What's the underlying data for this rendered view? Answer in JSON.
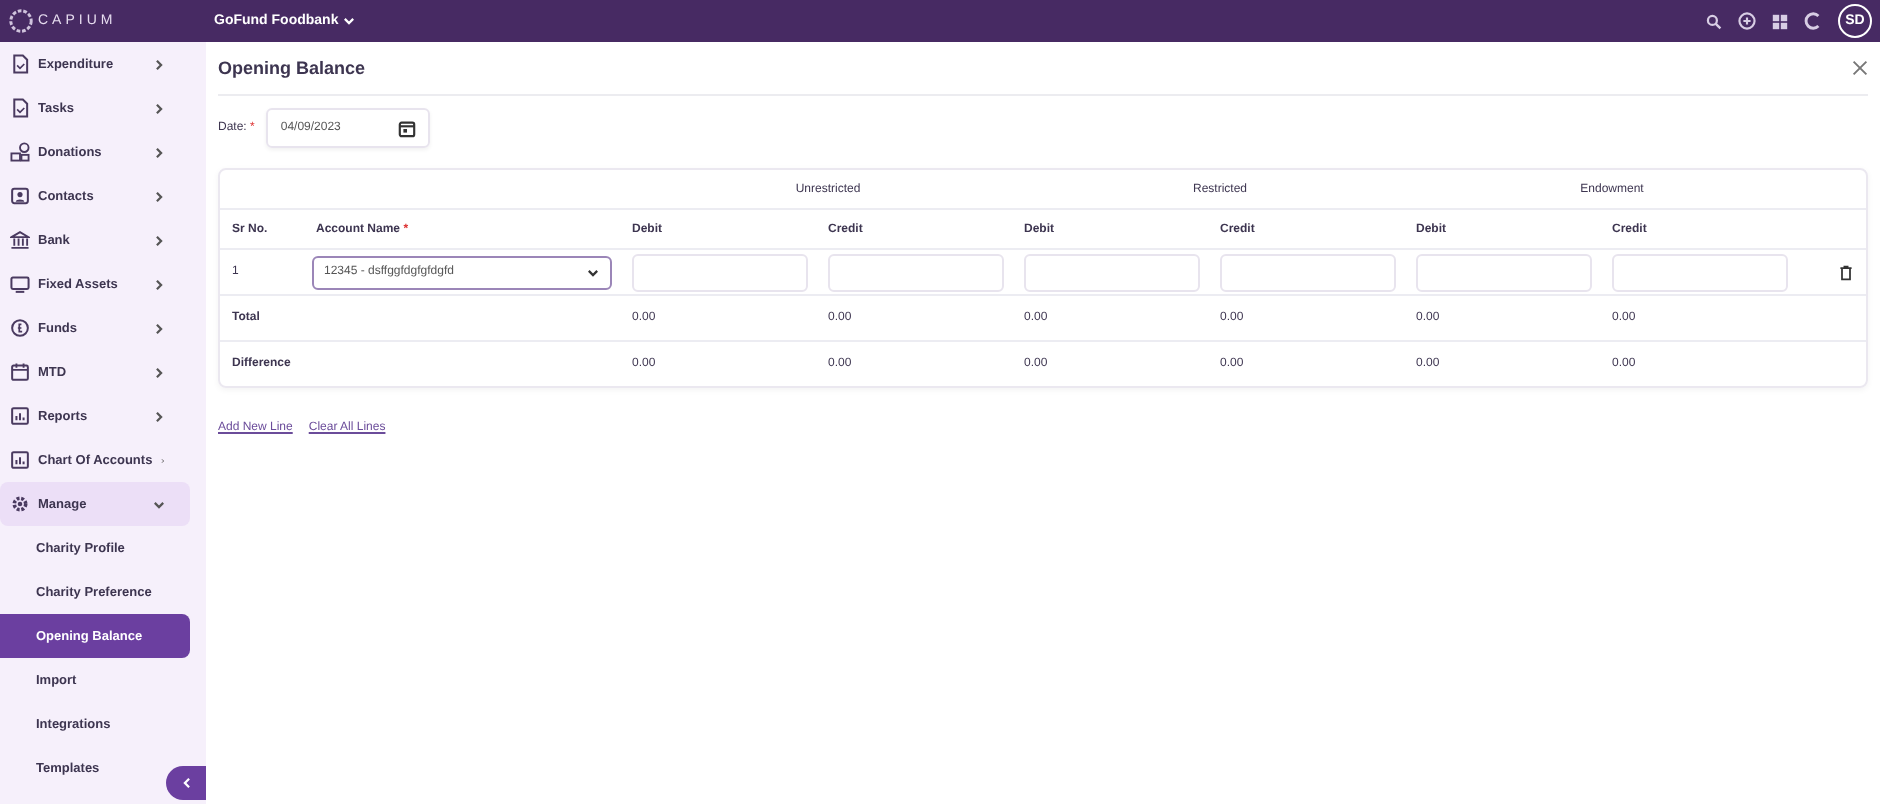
{
  "topbar": {
    "logo": "CAPIUM",
    "organisation": "GoFund Foodbank",
    "avatar": "SD"
  },
  "sidebar": {
    "items": [
      {
        "label": "Expenditure",
        "kind": "doc",
        "expanded": false,
        "selected": false
      },
      {
        "label": "Tasks",
        "kind": "doc",
        "expanded": false,
        "selected": false
      },
      {
        "label": "Donations",
        "kind": "coins",
        "expanded": false,
        "selected": false
      },
      {
        "label": "Contacts",
        "kind": "contact",
        "expanded": false,
        "selected": false
      },
      {
        "label": "Bank",
        "kind": "bank",
        "expanded": false,
        "selected": false
      },
      {
        "label": "Fixed Assets",
        "kind": "monitor",
        "expanded": false,
        "selected": false
      },
      {
        "label": "Funds",
        "kind": "coin",
        "expanded": false,
        "selected": false
      },
      {
        "label": "MTD",
        "kind": "calendar",
        "expanded": false,
        "selected": false
      },
      {
        "label": "Reports",
        "kind": "chart",
        "expanded": false,
        "selected": false
      },
      {
        "label": "Chart Of Accounts",
        "kind": "chart",
        "expanded": false,
        "selected": false
      },
      {
        "label": "Manage",
        "kind": "gear",
        "expanded": true,
        "selected": true,
        "children": [
          {
            "label": "Charity Profile",
            "selected": false
          },
          {
            "label": "Charity Preference",
            "selected": false
          },
          {
            "label": "Opening Balance",
            "selected": true
          },
          {
            "label": "Import",
            "selected": false
          },
          {
            "label": "Integrations",
            "selected": false
          },
          {
            "label": "Templates",
            "selected": false
          }
        ]
      }
    ]
  },
  "page": {
    "title": "Opening Balance",
    "date_label": "Date:",
    "required_mark": "*",
    "date": "04/09/2023"
  },
  "table": {
    "groups": [
      "Unrestricted",
      "Restricted",
      "Endowment"
    ],
    "columns": [
      "Sr No.",
      "Account Name",
      "Debit",
      "Credit",
      "Debit",
      "Credit",
      "Debit",
      "Credit"
    ],
    "account_required_mark": "*",
    "rows": [
      {
        "sr": "1",
        "account": "12345 - dsffggfdgfgfdgfd"
      }
    ],
    "totals": [
      {
        "label": "Total",
        "values": [
          "0.00",
          "0.00",
          "0.00",
          "0.00",
          "0.00",
          "0.00"
        ]
      },
      {
        "label": "Difference",
        "values": [
          "0.00",
          "0.00",
          "0.00",
          "0.00",
          "0.00",
          "0.00"
        ]
      }
    ]
  },
  "links": [
    "Add New Line",
    "Clear All Lines"
  ]
}
